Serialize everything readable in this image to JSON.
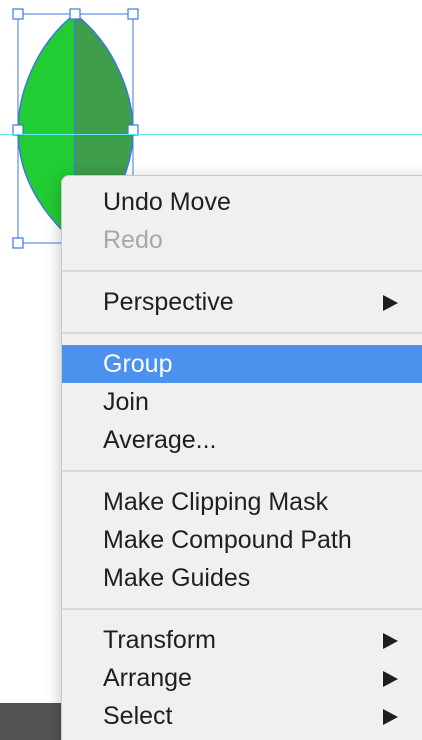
{
  "colors": {
    "leaf_light": "#22cc33",
    "leaf_dark": "#3e9e4a",
    "selection": "#3c78e6",
    "guide": "#5ee6ea",
    "highlight": "#4c91ee"
  },
  "menu": {
    "groups": [
      [
        {
          "label": "Undo Move",
          "enabled": true
        },
        {
          "label": "Redo",
          "enabled": false
        }
      ],
      [
        {
          "label": "Perspective",
          "submenu": true
        }
      ],
      [
        {
          "label": "Group",
          "highlighted": true
        },
        {
          "label": "Join"
        },
        {
          "label": "Average..."
        }
      ],
      [
        {
          "label": "Make Clipping Mask"
        },
        {
          "label": "Make Compound Path"
        },
        {
          "label": "Make Guides"
        }
      ],
      [
        {
          "label": "Transform",
          "submenu": true
        },
        {
          "label": "Arrange",
          "submenu": true
        },
        {
          "label": "Select",
          "submenu": true
        }
      ]
    ]
  }
}
